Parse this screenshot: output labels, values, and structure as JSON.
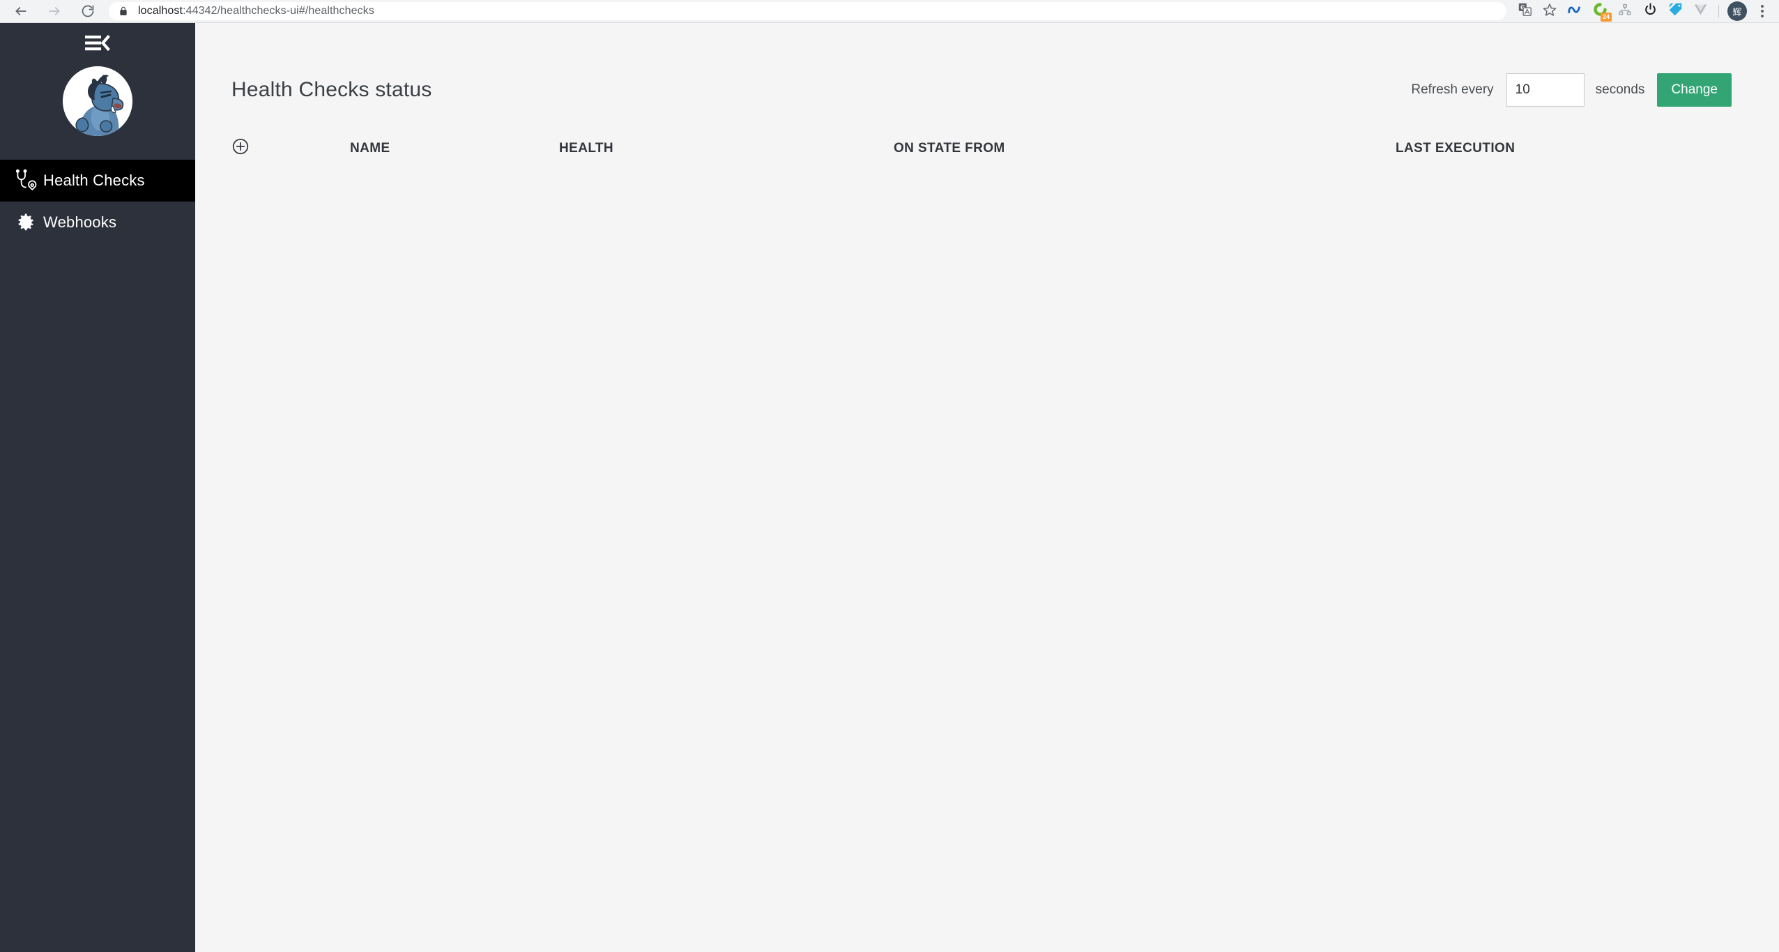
{
  "browser": {
    "back_icon": "back-arrow-icon",
    "forward_icon": "forward-arrow-icon",
    "reload_icon": "reload-icon",
    "lock_icon": "lock-icon",
    "url_host": "localhost",
    "url_path": ":44342/healthchecks-ui#/healthchecks",
    "url_full": "localhost:44342/healthchecks-ui#/healthchecks",
    "extensions": [
      {
        "name": "translate-icon",
        "label": "Google Translate"
      },
      {
        "name": "bookmark-star-icon",
        "label": "Bookmark this tab"
      },
      {
        "name": "nu-extension-icon",
        "label": "N"
      },
      {
        "name": "refresh-extension-icon",
        "label": "",
        "badge": "24"
      },
      {
        "name": "sitemap-extension-icon",
        "label": ""
      },
      {
        "name": "power-extension-icon",
        "label": ""
      },
      {
        "name": "tags-extension-icon",
        "label": ""
      },
      {
        "name": "vue-devtools-icon",
        "label": "V"
      }
    ],
    "avatar_initial": "辉",
    "menu_icon": "kebab-menu-icon"
  },
  "sidebar": {
    "collapse_icon": "collapse-sidebar-icon",
    "logo_alt": "healthchecks-rhino-logo",
    "items": [
      {
        "label": "Health Checks",
        "icon": "stethoscope-heart-icon",
        "active": true
      },
      {
        "label": "Webhooks",
        "icon": "gear-icon",
        "active": false
      }
    ]
  },
  "main": {
    "title": "Health Checks status",
    "refresh": {
      "prefix_label": "Refresh every",
      "value": "10",
      "placeholder": "",
      "suffix_label": "seconds",
      "button_label": "Change"
    },
    "table": {
      "toggle_icon": "expand-all-plus-icon",
      "columns": [
        "NAME",
        "HEALTH",
        "ON STATE FROM",
        "LAST EXECUTION"
      ],
      "rows": []
    }
  },
  "colors": {
    "sidebar_bg": "#2d313b",
    "sidebar_active_bg": "#000000",
    "main_bg": "#f5f5f5",
    "accent_green": "#33a473",
    "badge_orange": "#f7992e",
    "title_text": "#3a3f44"
  }
}
